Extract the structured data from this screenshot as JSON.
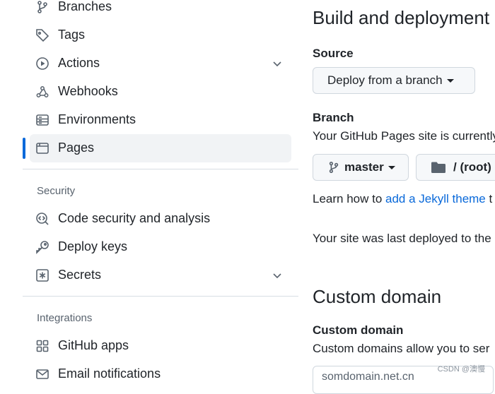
{
  "sidebar": {
    "items": [
      {
        "label": "Branches",
        "icon": "branch-icon"
      },
      {
        "label": "Tags",
        "icon": "tag-icon"
      },
      {
        "label": "Actions",
        "icon": "play-icon"
      },
      {
        "label": "Webhooks",
        "icon": "webhook-icon"
      },
      {
        "label": "Environments",
        "icon": "server-icon"
      },
      {
        "label": "Pages",
        "icon": "browser-icon",
        "active": true
      }
    ],
    "security_label": "Security",
    "security_items": [
      {
        "label": "Code security and analysis",
        "icon": "codescan-icon"
      },
      {
        "label": "Deploy keys",
        "icon": "key-icon"
      },
      {
        "label": "Secrets",
        "icon": "asterisk-icon"
      }
    ],
    "integrations_label": "Integrations",
    "integration_items": [
      {
        "label": "GitHub apps",
        "icon": "apps-icon"
      },
      {
        "label": "Email notifications",
        "icon": "mail-icon"
      }
    ]
  },
  "main": {
    "build_title": "Build and deployment",
    "source_label": "Source",
    "source_button": "Deploy from a branch",
    "branch_label": "Branch",
    "branch_desc": "Your GitHub Pages site is currently",
    "branch_button": "master",
    "folder_button": "/ (root)",
    "learn_prefix": "Learn how to ",
    "learn_link": "add a Jekyll theme",
    "learn_suffix": " t",
    "deploy_status": "Your site was last deployed to the",
    "custom_title": "Custom domain",
    "custom_label": "Custom domain",
    "custom_desc": "Custom domains allow you to ser",
    "custom_input_value": "somdomain.net.cn"
  },
  "watermark": "CSDN @澳慢",
  "colors": {
    "accent": "#0969da",
    "text": "#1f2328",
    "muted": "#59636e",
    "border": "#d0d7de"
  }
}
